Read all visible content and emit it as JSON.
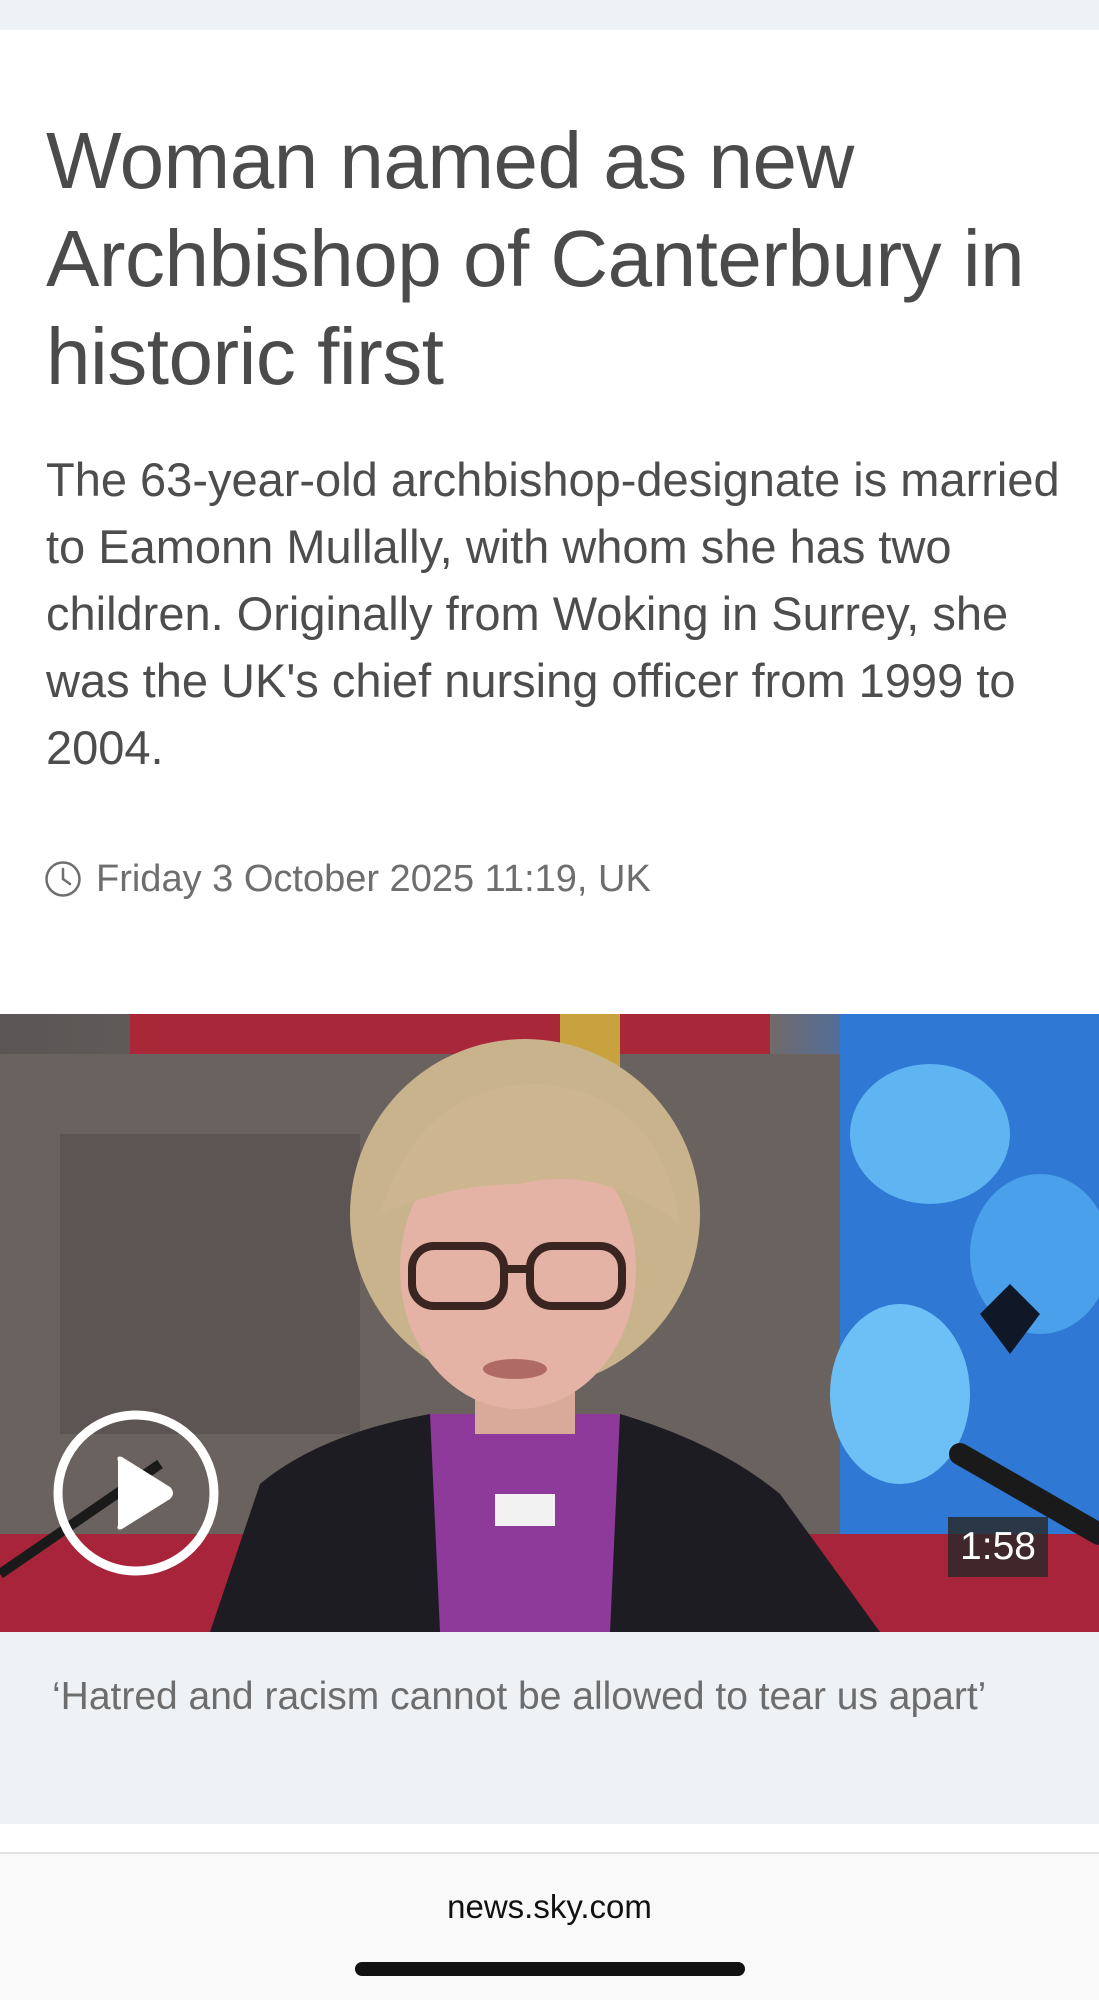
{
  "article": {
    "headline": "Woman named as new Archbishop of Canterbury in historic first",
    "standfirst": "The 63-year-old archbishop-designate is married to Eamonn Mullally, with whom she has two children. Originally from Woking in Surrey, she was the UK's chief nursing officer from 1999 to 2004.",
    "timestamp": "Friday 3 October 2025 11:19, UK"
  },
  "video": {
    "duration": "1:58",
    "caption": "‘Hatred and racism cannot be allowed to tear us apart’",
    "play_icon": "play-circle-icon"
  },
  "browser": {
    "url": "news.sky.com"
  },
  "icons": {
    "timestamp_icon": "clock-icon"
  },
  "colors": {
    "text_primary": "#4b4b4b",
    "caption_bg": "#eff2f4",
    "duration_bg": "#282828"
  }
}
